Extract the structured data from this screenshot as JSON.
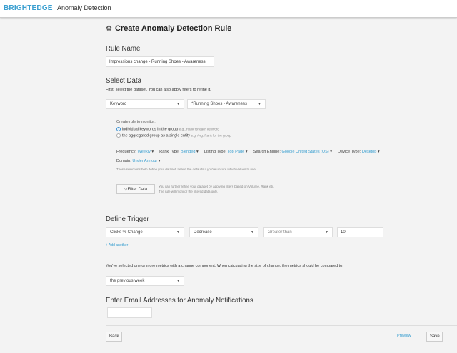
{
  "header": {
    "logo": "BRIGHTEDGE",
    "app_title": "Anomaly Detection"
  },
  "page": {
    "title": "Create Anomaly Detection Rule"
  },
  "rule_name": {
    "heading": "Rule Name",
    "value": "Impressions change - Running Shoes - Awareness"
  },
  "select_data": {
    "heading": "Select Data",
    "subtitle": "First, select the dataset. You can also apply filters to refine it.",
    "dataset": "Keyword",
    "group": "*Running Shoes - Awareness",
    "monitor_label": "Create rule to monitor:",
    "options": [
      {
        "label": "individual keywords in the group",
        "hint": "e.g., Rank for each keyword",
        "selected": true
      },
      {
        "label": "the aggregated group as a single entity",
        "hint": "e.g. Avg. Rank for the group",
        "selected": false
      }
    ],
    "filters": [
      {
        "label": "Frequency:",
        "value": "Weekly"
      },
      {
        "label": "Rank Type:",
        "value": "Blended"
      },
      {
        "label": "Listing Type:",
        "value": "Top Page"
      },
      {
        "label": "Search Engine:",
        "value": "Google United States (US)"
      },
      {
        "label": "Device Type:",
        "value": "Desktop"
      },
      {
        "label": "Domain:",
        "value": "Under Armour"
      }
    ],
    "filters_help": "These selections help define your dataset. Leave the defaults if you're unsure which values to use.",
    "filter_button": "Filter Data",
    "filter_help_1": "You can further refine your dataset by applying filters based on Volume, Rank etc.",
    "filter_help_2": "The rule will monitor the filtered data only."
  },
  "trigger": {
    "heading": "Define Trigger",
    "metric": "Clicks % Change",
    "direction": "Decrease",
    "operator": "Greater than",
    "value": "10",
    "add_another": "+ Add another",
    "compare_text": "You've selected one or more metrics with a change component. When calculating the size of change, the metrics should be compared to:",
    "compare_value": "the previous week"
  },
  "email": {
    "heading": "Enter Email Addresses for Anomaly Notifications",
    "value": ""
  },
  "footer": {
    "back": "Back",
    "preview": "Preview",
    "save": "Save"
  },
  "colors": {
    "accent": "#3a9fd0",
    "background": "#f3f3f3"
  }
}
